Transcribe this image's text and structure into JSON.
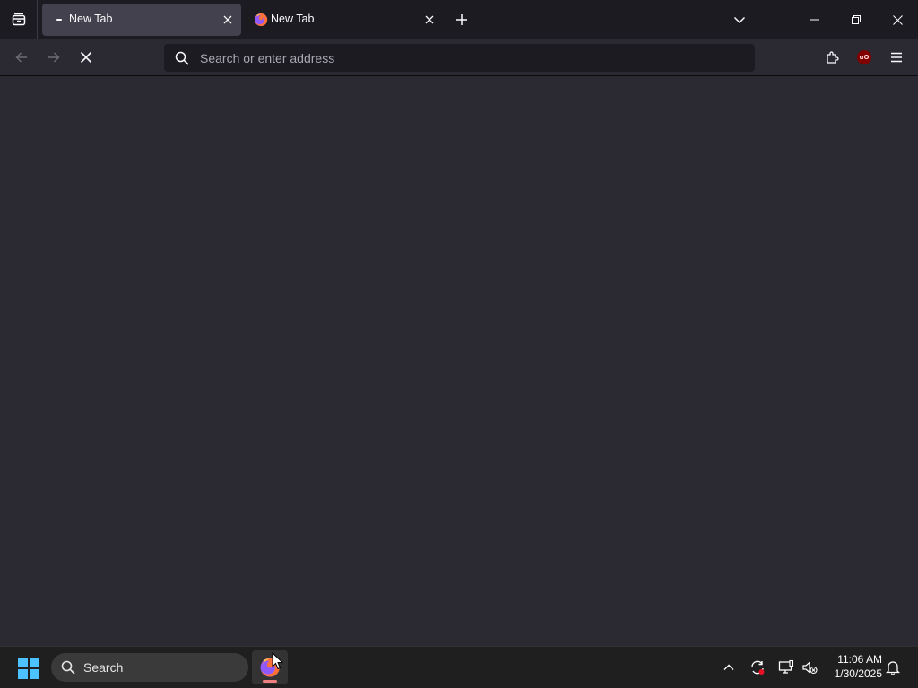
{
  "browser": {
    "tabs": [
      {
        "title": "New Tab",
        "selected": true,
        "loading": true
      },
      {
        "title": "New Tab",
        "selected": false,
        "loading": false
      }
    ],
    "urlbar": {
      "placeholder": "Search or enter address",
      "value": ""
    },
    "extensions": {
      "ublock_badge": "uO"
    }
  },
  "taskbar": {
    "search_label": "Search",
    "clock": {
      "time": "11:06 AM",
      "date": "1/30/2025"
    }
  },
  "icons": {
    "tab_manager": "tab-manager-icon",
    "close": "close-icon",
    "new_tab": "plus-icon",
    "list_all_tabs": "chevron-down-icon",
    "back": "arrow-left-icon",
    "forward": "arrow-right-icon",
    "stop": "stop-icon",
    "search": "search-icon",
    "extensions": "puzzle-icon",
    "menu": "hamburger-icon"
  },
  "colors": {
    "tabstrip_bg": "#1c1b22",
    "selected_tab_bg": "#42414d",
    "content_bg": "#2b2a33",
    "taskbar_bg": "#1f1f1f",
    "windows_accent": "#4cc2ff"
  }
}
